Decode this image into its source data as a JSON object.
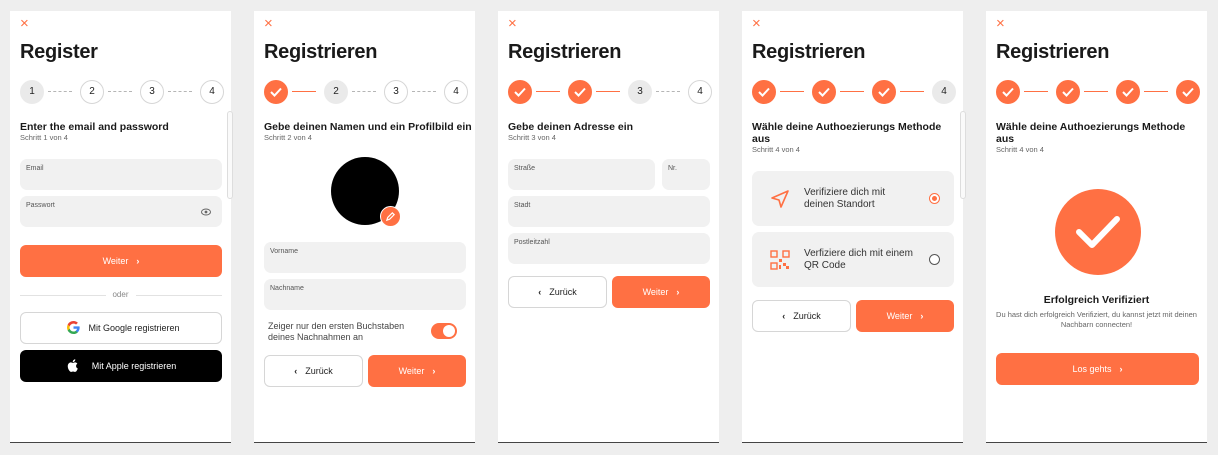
{
  "close_icon": "×",
  "colors": {
    "accent": "#ff7043"
  },
  "screen1": {
    "title": "Register",
    "steps": [
      "1",
      "2",
      "3",
      "4"
    ],
    "heading": "Enter the email and password",
    "sub": "Schritt 1 von 4",
    "email_label": "Email",
    "password_label": "Passwort",
    "next_label": "Weiter",
    "or_label": "oder",
    "google_label": "Mit Google registrieren",
    "apple_label": "Mit Apple registrieren"
  },
  "screen2": {
    "title": "Registrieren",
    "steps": [
      "2",
      "3",
      "4"
    ],
    "heading": "Gebe deinen Namen und ein Profilbild ein",
    "sub": "Schritt 2 von 4",
    "firstname_label": "Vorname",
    "lastname_label": "Nachname",
    "toggle_text": "Zeiger nur den ersten Buchstaben deines Nachnahmen an",
    "toggle_on": true,
    "back_label": "Zurück",
    "next_label": "Weiter"
  },
  "screen3": {
    "title": "Registrieren",
    "steps": [
      "3",
      "4"
    ],
    "heading": "Gebe deinen Adresse ein",
    "sub": "Schritt 3 von 4",
    "street_label": "Straße",
    "number_label": "Nr.",
    "city_label": "Stadt",
    "zip_label": "Postleitzahl",
    "back_label": "Zurück",
    "next_label": "Weiter"
  },
  "screen4": {
    "title": "Registrieren",
    "steps": [
      "4"
    ],
    "heading": "Wähle deine Authoezierungs Methode aus",
    "sub": "Schritt 4 von 4",
    "options": [
      {
        "label": "Verifiziere dich mit deinen Standort",
        "icon": "location-arrow-icon",
        "selected": true
      },
      {
        "label": "Verfiziere dich mit einem QR Code",
        "icon": "qr-code-icon",
        "selected": false
      }
    ],
    "back_label": "Zurück",
    "next_label": "Weiter"
  },
  "screen5": {
    "title": "Registrieren",
    "heading": "Wähle deine Authoezierungs Methode aus",
    "sub": "Schritt 4 von 4",
    "success_title": "Erfolgreich Verifiziert",
    "success_text": "Du hast dich erfolgreich Verifiziert, du kannst jetzt mit deinen Nachbarn connecten!",
    "cta_label": "Los gehts"
  }
}
